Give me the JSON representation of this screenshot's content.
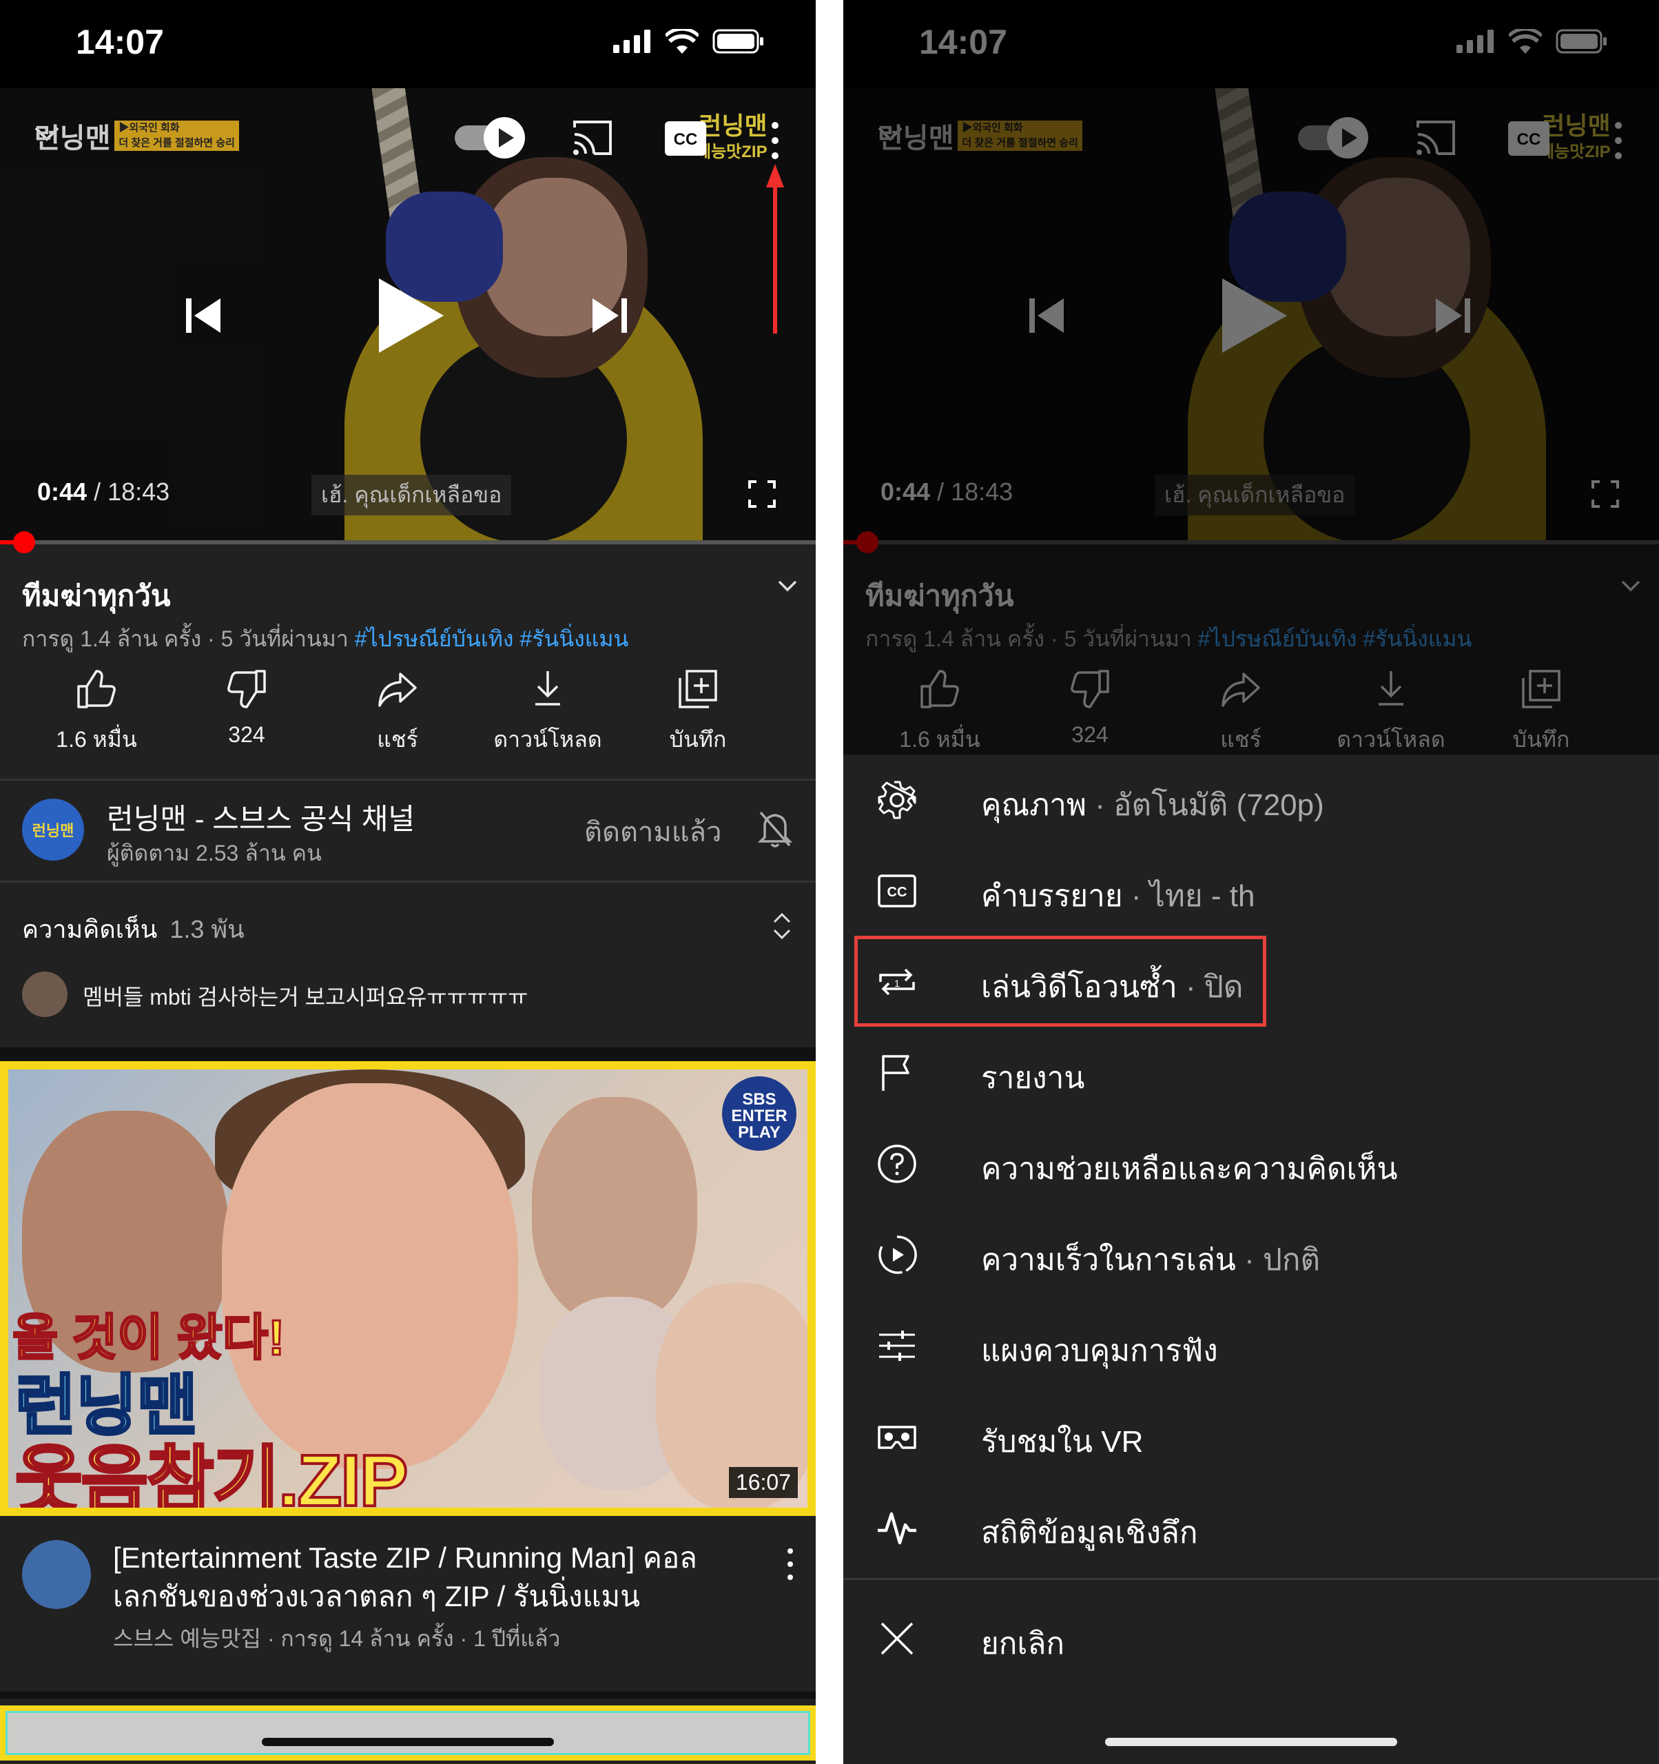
{
  "status": {
    "time": "14:07"
  },
  "player": {
    "channel_logo": "런닝맨",
    "logo_tag_1": "▶외국인 회화",
    "logo_tag_2": "더 찾은 거를 절절하면 승리",
    "corner_logo_1": "런닝맨",
    "corner_logo_2": "예능맛ZIP",
    "current_time": "0:44",
    "duration": "18:43",
    "caption": "เฮ้. คุณเด็กเหลือขอ",
    "progress": 0.0295,
    "icons": [
      "collapse-chevron-icon",
      "autoplay-toggle-icon",
      "cast-icon",
      "cc-icon",
      "more-vert-icon",
      "prev-icon",
      "play-icon",
      "next-icon",
      "fullscreen-icon"
    ]
  },
  "video": {
    "title": "ทีมฆ่าทุกวัน",
    "views": "การดู 1.4 ล้าน ครั้ง · 5 วันที่ผ่านมา",
    "hashtag1": "#ไปรษณีย์บันเทิง",
    "hashtag2": "#รันนิ่งแมน"
  },
  "actions": [
    {
      "label": "1.6 หมื่น",
      "icon": "like-icon"
    },
    {
      "label": "324",
      "icon": "dislike-icon"
    },
    {
      "label": "แชร์",
      "icon": "share-icon"
    },
    {
      "label": "ดาวน์โหลด",
      "icon": "download-icon"
    },
    {
      "label": "บันทึก",
      "icon": "save-icon"
    }
  ],
  "channel": {
    "avatar_text": "런닝맨",
    "name": "런닝맨 - 스브스 공식 채널",
    "subscribers": "ผู้ติดตาม 2.53 ล้าน คน",
    "subscribe_label": "ติดตามแล้ว"
  },
  "comments": {
    "header": "ความคิดเห็น",
    "count": "1.3 พัน",
    "top_comment": "멤버들 mbti 검사하는거 보고시퍼요유ㅠㅠㅠㅠㅠ"
  },
  "next_video": {
    "thumb_text_1": "올 것이 왔다!",
    "thumb_text_2": "런닝맨",
    "thumb_text_3": "웃음참기.ZIP",
    "sbs_badge": "SBS ENTER PLAY",
    "duration": "16:07",
    "title": "[Entertainment Taste ZIP / Running Man] คอลเลกชันของช่วงเวลาตลก ๆ ZIP / รันนิ่งแมน",
    "meta": "스브스 예능맛집 · การดู 14 ล้าน ครั้ง · 1 ปีที่แล้ว"
  },
  "menu": {
    "items": [
      {
        "label": "คุณภาพ",
        "sub": " · อัตโนมัติ (720p)",
        "icon": "gear-icon"
      },
      {
        "label": "คำบรรยาย",
        "sub": " · ไทย - th",
        "icon": "cc-icon"
      },
      {
        "label": "เล่นวิดีโอวนซ้ำ",
        "sub": " · ปิด",
        "icon": "loop-icon"
      },
      {
        "label": "รายงาน",
        "sub": "",
        "icon": "flag-icon"
      },
      {
        "label": "ความช่วยเหลือและความคิดเห็น",
        "sub": "",
        "icon": "help-icon"
      },
      {
        "label": "ความเร็วในการเล่น",
        "sub": " · ปกติ",
        "icon": "playback-speed-icon"
      },
      {
        "label": "แผงควบคุมการฟัง",
        "sub": "",
        "icon": "equalizer-icon"
      },
      {
        "label": "รับชมใน VR",
        "sub": "",
        "icon": "vr-icon"
      },
      {
        "label": "สถิติข้อมูลเชิงลึก",
        "sub": "",
        "icon": "stats-icon"
      }
    ],
    "cancel": "ยกเลิก"
  },
  "colors": {
    "accent": "#ff0000",
    "highlight_box": "#e8413c",
    "link": "#3ea6ff",
    "background": "#212121"
  }
}
